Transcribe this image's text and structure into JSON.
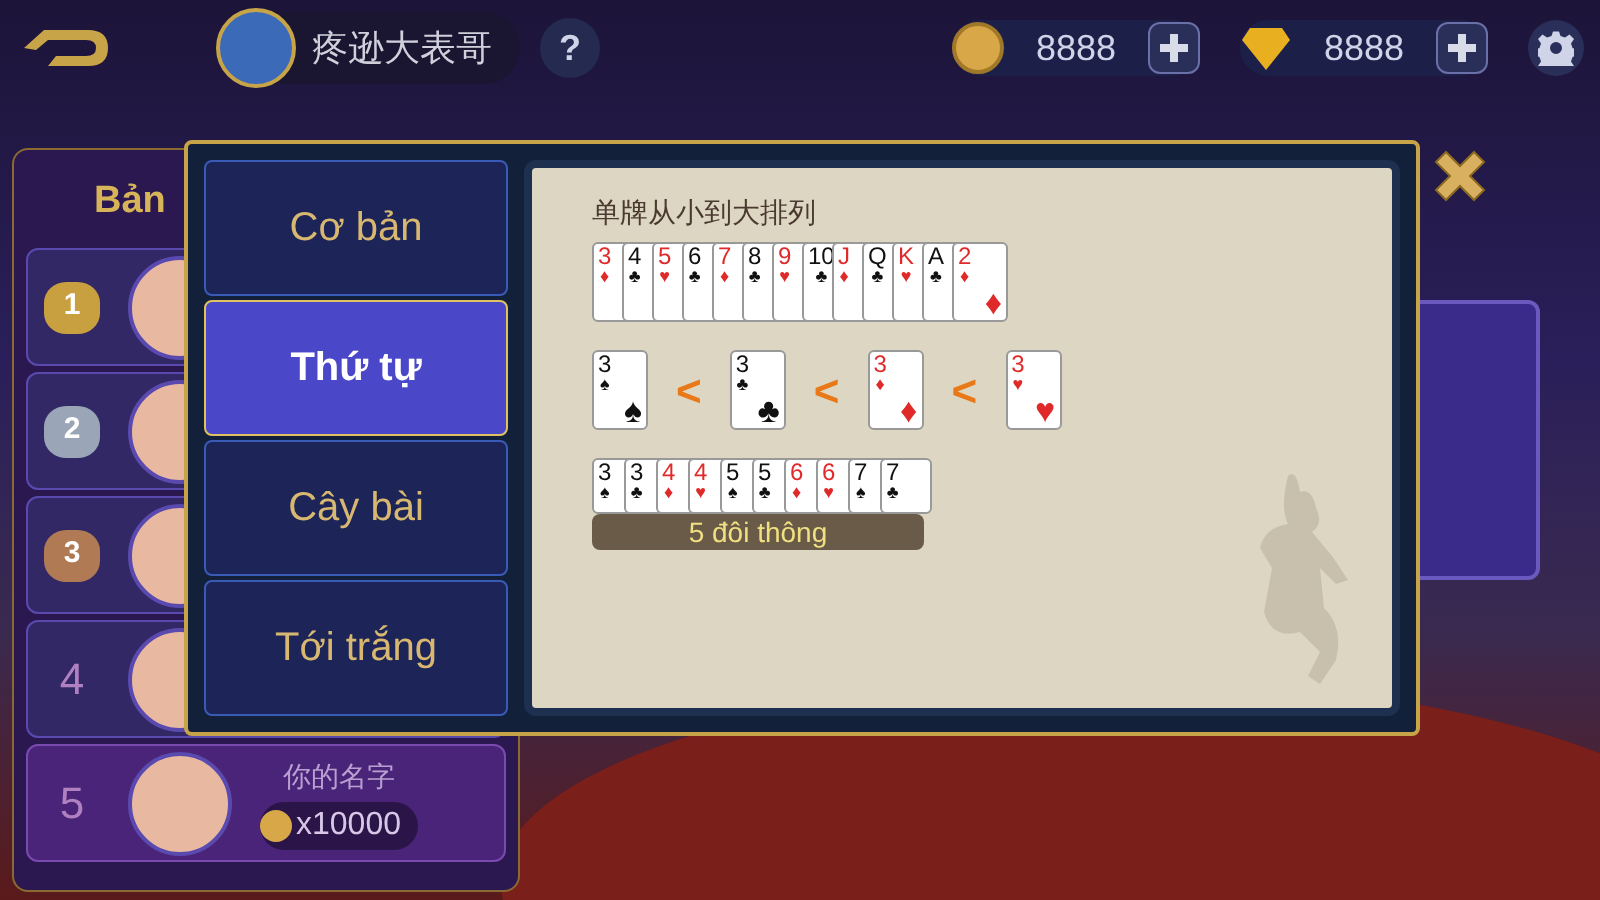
{
  "top_bar": {
    "player_name": "疼逊大表哥",
    "help": "?",
    "coins": "8888",
    "gems": "8888"
  },
  "leaderboard": {
    "title": "Bản",
    "rows": [
      {
        "rank": "1",
        "kind": "medal",
        "color": "#c9a040"
      },
      {
        "rank": "2",
        "kind": "medal",
        "color": "#9aa6b8"
      },
      {
        "rank": "3",
        "kind": "medal",
        "color": "#b07a55"
      },
      {
        "rank": "4",
        "kind": "plain"
      },
      {
        "rank": "5",
        "kind": "self",
        "name": "你的名字",
        "coins": "x10000"
      }
    ]
  },
  "rules_dialog": {
    "tabs": [
      {
        "label": "Cơ bản",
        "selected": false
      },
      {
        "label": "Thứ tự",
        "selected": true
      },
      {
        "label": "Cây bài",
        "selected": false
      },
      {
        "label": "Tới trắng",
        "selected": false
      }
    ],
    "heading": "单牌从小到大排列",
    "single_order": [
      {
        "rank": "3",
        "suit": "♦",
        "color": "#e02a2a"
      },
      {
        "rank": "4",
        "suit": "♣",
        "color": "#111111"
      },
      {
        "rank": "5",
        "suit": "♥",
        "color": "#e02a2a"
      },
      {
        "rank": "6",
        "suit": "♣",
        "color": "#111111"
      },
      {
        "rank": "7",
        "suit": "♦",
        "color": "#e02a2a"
      },
      {
        "rank": "8",
        "suit": "♣",
        "color": "#111111"
      },
      {
        "rank": "9",
        "suit": "♥",
        "color": "#e02a2a"
      },
      {
        "rank": "10",
        "suit": "♣",
        "color": "#111111"
      },
      {
        "rank": "J",
        "suit": "♦",
        "color": "#e02a2a"
      },
      {
        "rank": "Q",
        "suit": "♣",
        "color": "#111111"
      },
      {
        "rank": "K",
        "suit": "♥",
        "color": "#e02a2a"
      },
      {
        "rank": "A",
        "suit": "♣",
        "color": "#111111"
      },
      {
        "rank": "2",
        "suit": "♦",
        "color": "#e02a2a"
      }
    ],
    "suit_order": [
      {
        "rank": "3",
        "suit": "♠",
        "color": "#111111"
      },
      {
        "rank": "3",
        "suit": "♣",
        "color": "#111111"
      },
      {
        "rank": "3",
        "suit": "♦",
        "color": "#e02a2a"
      },
      {
        "rank": "3",
        "suit": "♥",
        "color": "#e02a2a"
      }
    ],
    "suit_separator": "<",
    "pairs": [
      {
        "rank": "3",
        "suit": "♠",
        "color": "#111111"
      },
      {
        "rank": "3",
        "suit": "♣",
        "color": "#111111"
      },
      {
        "rank": "4",
        "suit": "♦",
        "color": "#e02a2a"
      },
      {
        "rank": "4",
        "suit": "♥",
        "color": "#e02a2a"
      },
      {
        "rank": "5",
        "suit": "♠",
        "color": "#111111"
      },
      {
        "rank": "5",
        "suit": "♣",
        "color": "#111111"
      },
      {
        "rank": "6",
        "suit": "♦",
        "color": "#e02a2a"
      },
      {
        "rank": "6",
        "suit": "♥",
        "color": "#e02a2a"
      },
      {
        "rank": "7",
        "suit": "♠",
        "color": "#111111"
      },
      {
        "rank": "7",
        "suit": "♣",
        "color": "#111111"
      }
    ],
    "pairs_label": "5 đôi thông"
  }
}
